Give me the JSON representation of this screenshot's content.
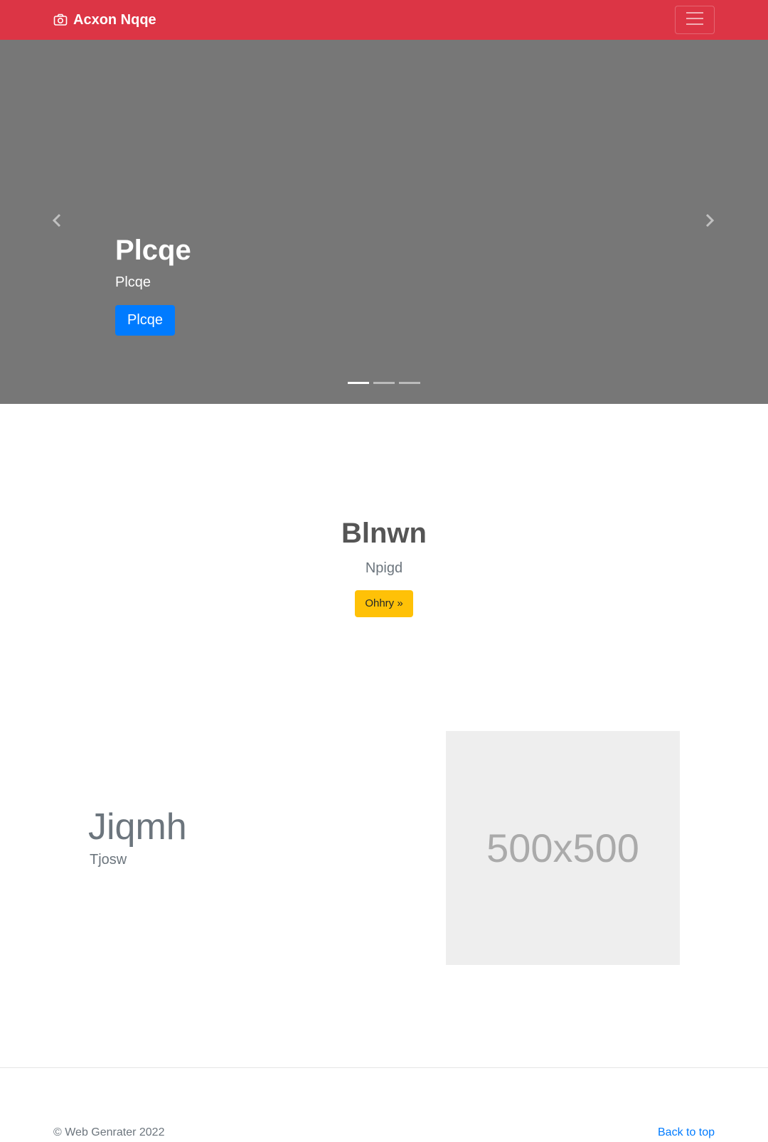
{
  "navbar": {
    "brand": "Acxon Nqqe",
    "brand_icon": "camera-icon",
    "toggler_icon": "hamburger-menu-icon",
    "background": "#dc3545"
  },
  "carousel": {
    "background": "#777777",
    "slide": {
      "heading": "Plcqe",
      "text": "Plcqe",
      "button": "Plcqe"
    },
    "indicators": [
      {
        "active": true
      },
      {
        "active": false
      },
      {
        "active": false
      }
    ],
    "prev_icon": "chevron-left-icon",
    "next_icon": "chevron-right-icon"
  },
  "intro": {
    "heading": "Blnwn",
    "lead": "Npigd",
    "button": "Ohhry »",
    "button_color": "#ffc107"
  },
  "feature": {
    "heading": "Jiqmh",
    "subtext": "Tjosw",
    "image_label": "500x500"
  },
  "footer": {
    "copyright": "© Web Genrater 2022",
    "back_to_top": "Back to top"
  }
}
